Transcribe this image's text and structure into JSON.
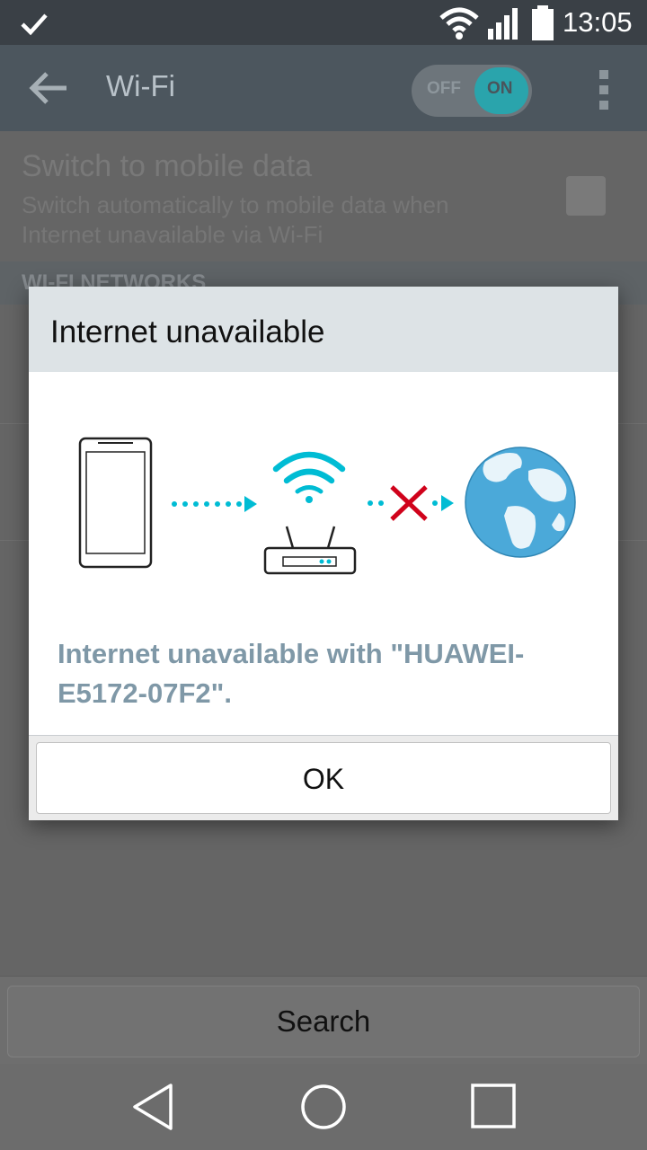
{
  "status_bar": {
    "time": "13:05",
    "icons": [
      "check-icon",
      "wifi-icon",
      "signal-icon",
      "battery-icon"
    ]
  },
  "action_bar": {
    "title": "Wi-Fi",
    "toggle": {
      "off_label": "OFF",
      "on_label": "ON",
      "state": "on"
    }
  },
  "settings": {
    "mobile_data": {
      "title": "Switch to mobile data",
      "description": "Switch automatically to mobile data when Internet unavailable via Wi-Fi",
      "checked": false
    },
    "section_header": "WI-FI NETWORKS"
  },
  "dialog": {
    "title": "Internet unavailable",
    "message": "Internet unavailable with \"HUAWEI-E5172-07F2\".",
    "ok_label": "OK"
  },
  "search": {
    "label": "Search"
  },
  "colors": {
    "accent": "#00bcd4",
    "error_cross": "#d0021b",
    "message_text": "#7f98a7",
    "globe": "#4ba9d9"
  }
}
